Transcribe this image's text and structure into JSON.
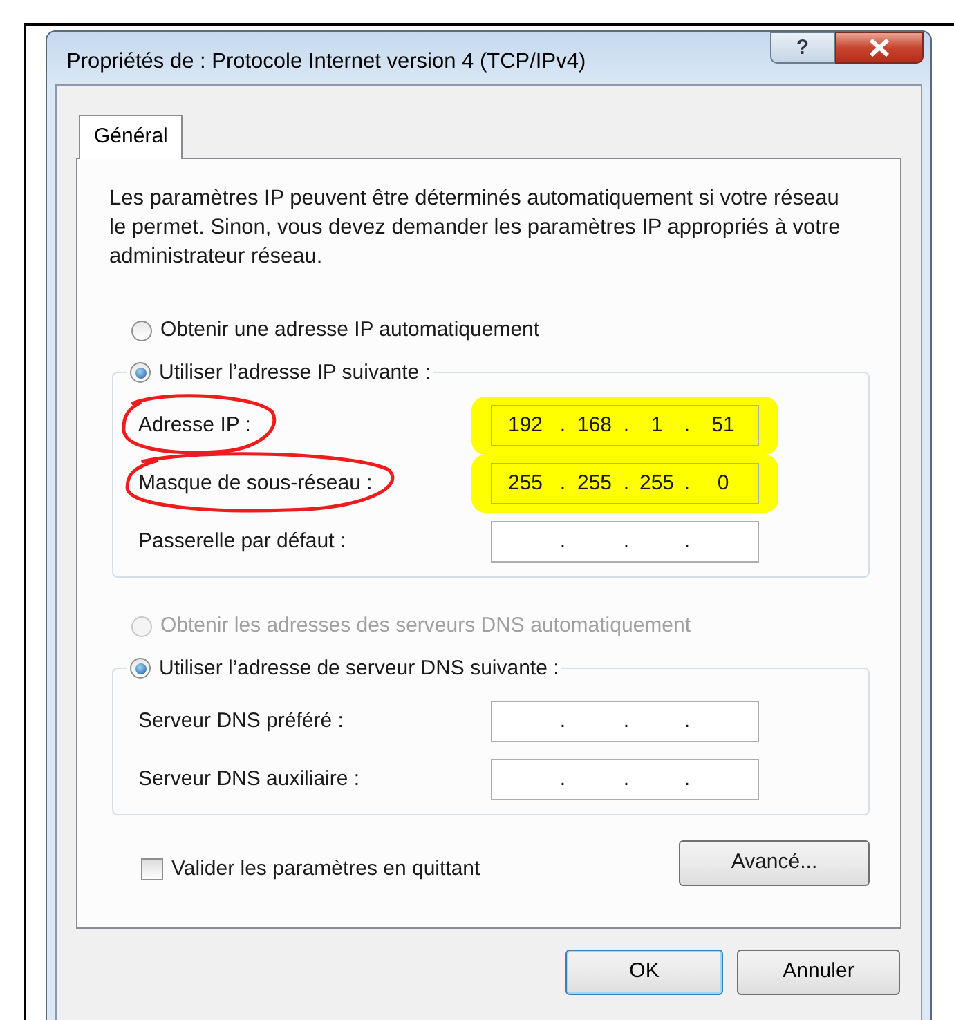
{
  "window": {
    "title": "Propriétés de : Protocole Internet version 4 (TCP/IPv4)",
    "help": "?"
  },
  "tabs": [
    {
      "label": "Général",
      "selected": true
    }
  ],
  "intro": "Les paramètres IP peuvent être déterminés automatiquement si votre réseau le permet. Sinon, vous devez demander les paramètres IP appropriés à votre administrateur réseau.",
  "ip_options": [
    {
      "label": "Obtenir une adresse IP automatiquement",
      "selected": false,
      "disabled": false
    },
    {
      "label": "Utiliser l’adresse IP suivante :",
      "selected": true,
      "disabled": false
    }
  ],
  "ip_fields": [
    {
      "label": "Adresse IP :",
      "octets": [
        "192",
        "168",
        "1",
        "51"
      ],
      "dots": [
        ".",
        ".",
        "."
      ],
      "circled": true,
      "highlighted": true
    },
    {
      "label": "Masque de sous-réseau :",
      "octets": [
        "255",
        "255",
        "255",
        "0"
      ],
      "dots": [
        ".",
        ".",
        "."
      ],
      "circled": true,
      "highlighted": true
    },
    {
      "label": "Passerelle par défaut :",
      "dots": [
        ".",
        ".",
        "."
      ],
      "circled": false,
      "highlighted": false
    }
  ],
  "dns_options": [
    {
      "label": "Obtenir les adresses des serveurs DNS automatiquement",
      "selected": false,
      "disabled": true
    },
    {
      "label": "Utiliser l’adresse de serveur DNS suivante :",
      "selected": true,
      "disabled": false
    }
  ],
  "dns_fields": [
    {
      "label": "Serveur DNS préféré :",
      "dots": [
        ".",
        ".",
        "."
      ],
      "circled": false,
      "highlighted": false
    },
    {
      "label": "Serveur DNS auxiliaire :",
      "dots": [
        ".",
        ".",
        "."
      ],
      "circled": false,
      "highlighted": false
    }
  ],
  "validate": {
    "label": "Valider les paramètres en quittant",
    "checked": false
  },
  "advanced_button": "Avancé...",
  "buttons": [
    {
      "label": "OK",
      "default": true
    },
    {
      "label": "Annuler",
      "default": false
    }
  ]
}
